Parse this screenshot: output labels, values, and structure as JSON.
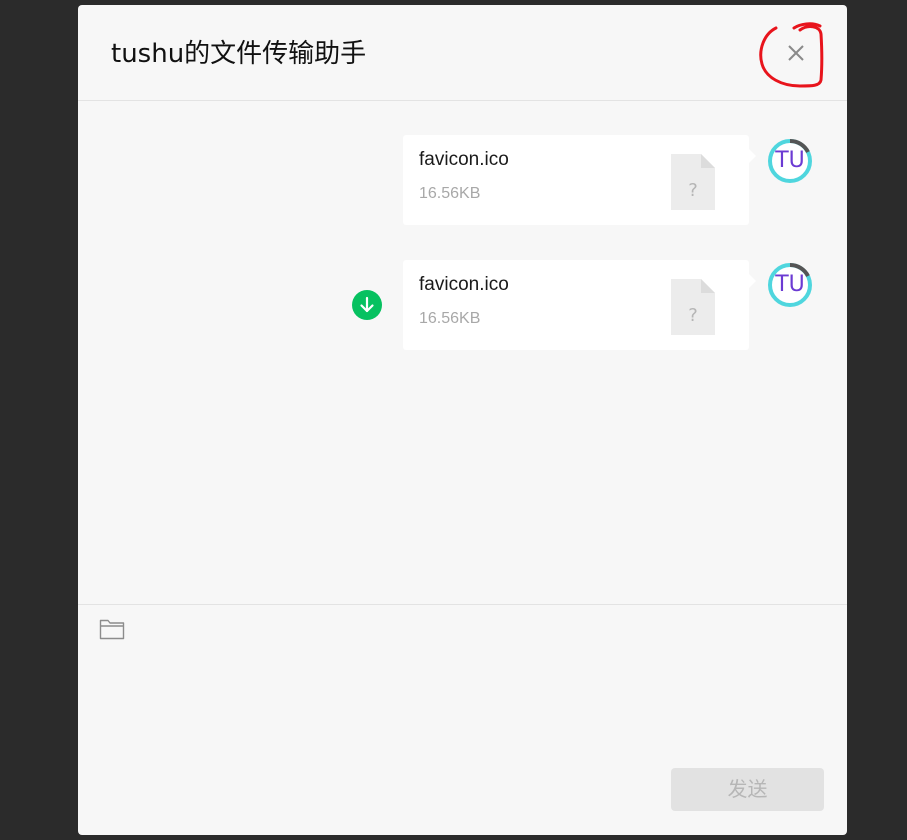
{
  "window": {
    "title": "tushu的文件传输助手"
  },
  "messages": [
    {
      "file_name": "favicon.ico",
      "file_size": "16.56KB",
      "file_icon": "unknown-file-icon",
      "avatar_text": "TU",
      "has_download": false
    },
    {
      "file_name": "favicon.ico",
      "file_size": "16.56KB",
      "file_icon": "unknown-file-icon",
      "avatar_text": "TU",
      "has_download": true
    }
  ],
  "file_icon_glyph": "?",
  "toolbar": {
    "folder_icon": "folder-icon"
  },
  "composer": {
    "send_label": "发送"
  },
  "colors": {
    "download_green": "#07c160",
    "avatar_ring": "#4fd6de",
    "avatar_text": "#6b3bd3",
    "annotation_red": "#e8141c"
  }
}
